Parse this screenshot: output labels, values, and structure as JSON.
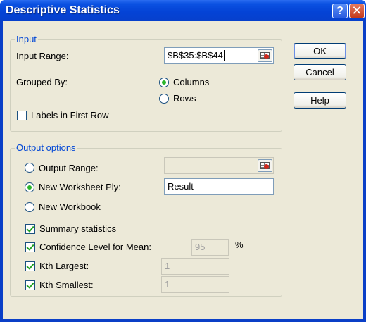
{
  "window": {
    "title": "Descriptive Statistics",
    "help_icon": "question-mark",
    "close_icon": "x-mark",
    "help_symbol": "?",
    "close_symbol": "✕"
  },
  "input_group": {
    "legend": "Input",
    "input_range_label": "Input Range:",
    "input_range_value": "$B$35:$B$44",
    "grouped_by_label": "Grouped By:",
    "columns_label": "Columns",
    "rows_label": "Rows",
    "labels_first_row_label": "Labels in First Row"
  },
  "output_group": {
    "legend": "Output options",
    "output_range_label": "Output Range:",
    "output_range_value": "",
    "new_worksheet_label": "New Worksheet Ply:",
    "new_worksheet_value": "Result",
    "new_workbook_label": "New Workbook",
    "summary_label": "Summary statistics",
    "confidence_label": "Confidence Level for Mean:",
    "confidence_value": "95",
    "percent": "%",
    "kth_largest_label": "Kth Largest:",
    "kth_largest_value": "1",
    "kth_smallest_label": "Kth Smallest:",
    "kth_smallest_value": "1"
  },
  "buttons": {
    "ok": "OK",
    "cancel": "Cancel",
    "help": "Help"
  },
  "state": {
    "grouped_by": "Columns",
    "labels_first_row": false,
    "output_option": "New Worksheet Ply",
    "summary_statistics": true,
    "confidence_level": true,
    "kth_largest": true,
    "kth_smallest": true
  },
  "colors": {
    "titlebar": "#0443d6",
    "dialog_face": "#ece9d8",
    "group_label": "#0046d5",
    "check_mark": "#21a121"
  }
}
